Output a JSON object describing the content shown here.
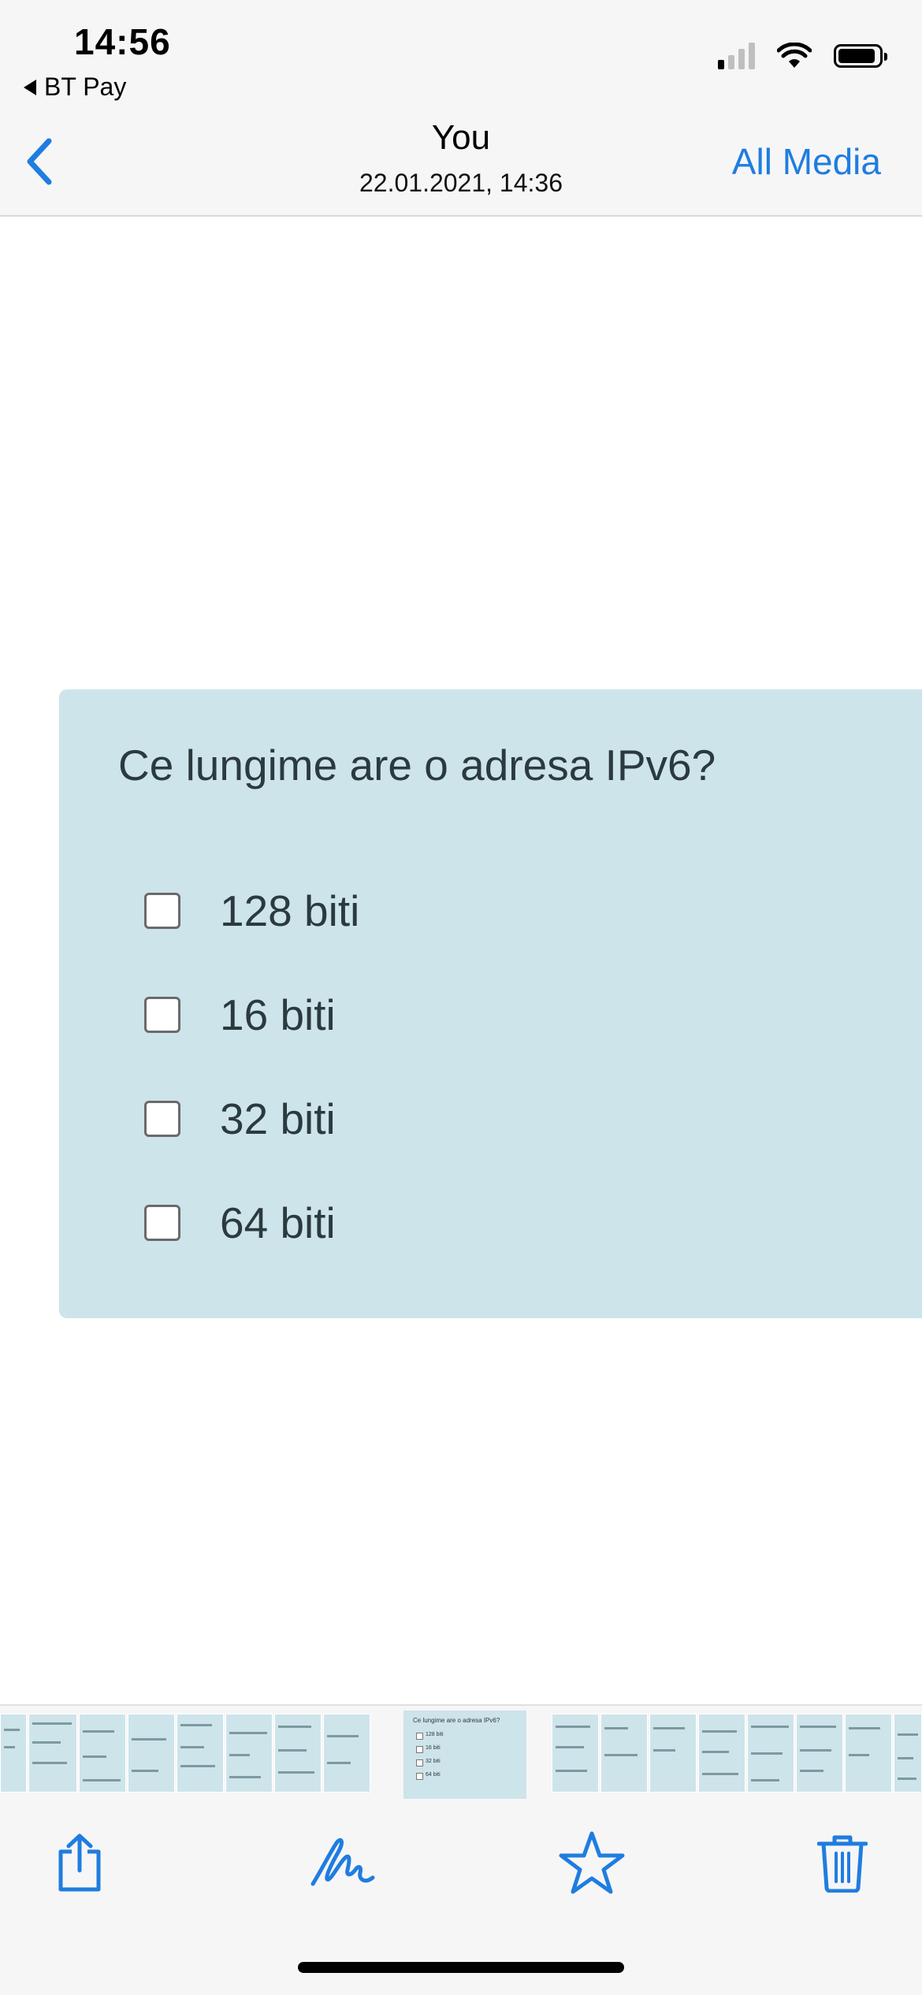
{
  "status_bar": {
    "time": "14:56",
    "back_app": "BT Pay",
    "signal_bars_active": 1,
    "signal_bars_total": 4
  },
  "nav": {
    "title": "You",
    "subtitle": "22.01.2021, 14:36",
    "right_action": "All Media",
    "back_icon": "chevron-left-icon",
    "accent_color": "#1f7de0"
  },
  "quiz": {
    "question": "Ce lungime are o adresa IPv6?",
    "options": [
      {
        "label": "128 biti",
        "checked": false
      },
      {
        "label": "16 biti",
        "checked": false
      },
      {
        "label": "32 biti",
        "checked": false
      },
      {
        "label": "64 biti",
        "checked": false
      }
    ],
    "card_color": "#cde4ea"
  },
  "thumbnail_strip": {
    "active_thumb": {
      "question": "Ce lungime are o adresa IPv6?",
      "options": [
        "128 biti",
        "16 biti",
        "32 biti",
        "64 biti"
      ]
    }
  },
  "toolbar": {
    "items": [
      {
        "name": "share",
        "icon": "share-icon"
      },
      {
        "name": "markup",
        "icon": "markup-pen-icon"
      },
      {
        "name": "favorite",
        "icon": "star-icon"
      },
      {
        "name": "delete",
        "icon": "trash-icon"
      }
    ]
  }
}
